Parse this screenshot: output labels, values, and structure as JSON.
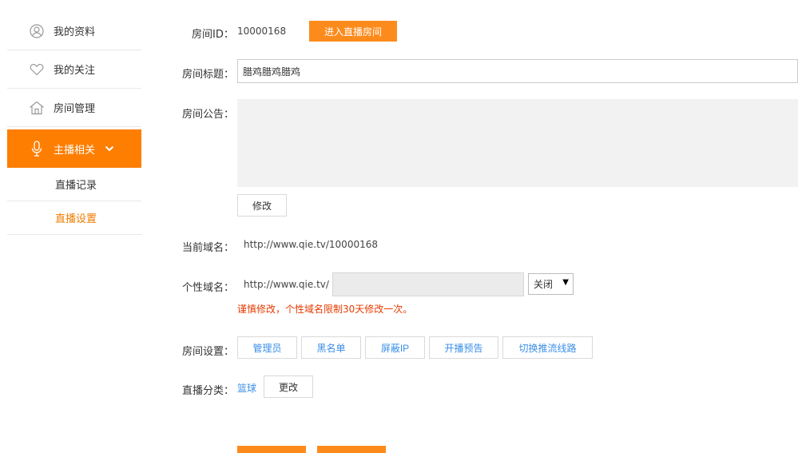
{
  "sidebar": {
    "items": [
      {
        "label": "我的资料",
        "icon": "user-icon"
      },
      {
        "label": "我的关注",
        "icon": "heart-icon"
      },
      {
        "label": "房间管理",
        "icon": "house-icon"
      },
      {
        "label": "主播相关",
        "icon": "microphone-icon"
      }
    ],
    "subitems": [
      {
        "label": "直播记录"
      },
      {
        "label": "直播设置"
      }
    ]
  },
  "form": {
    "room_id_label": "房间ID：",
    "room_id_value": "10000168",
    "enter_room_button": "进入直播房间",
    "title_label": "房间标题：",
    "title_value": "腊鸡腊鸡腊鸡",
    "notice_label": "房间公告：",
    "modify_button": "修改",
    "current_domain_label": "当前域名：",
    "current_domain_value": "http://www.qie.tv/10000168",
    "custom_domain_label": "个性域名：",
    "custom_domain_prefix": "http://www.qie.tv/",
    "custom_domain_select": "关闭",
    "custom_domain_warning": "谨慎修改，个性域名限制30天修改一次。",
    "room_settings_label": "房间设置：",
    "room_settings_buttons": [
      "管理员",
      "黑名单",
      "屏蔽IP",
      "开播预告",
      "切换推流线路"
    ],
    "category_label": "直播分类：",
    "category_value": "篮球",
    "change_button": "更改"
  },
  "colors": {
    "accent": "#fd7e00",
    "link": "#3a8ee6",
    "warning": "#e53b00"
  }
}
